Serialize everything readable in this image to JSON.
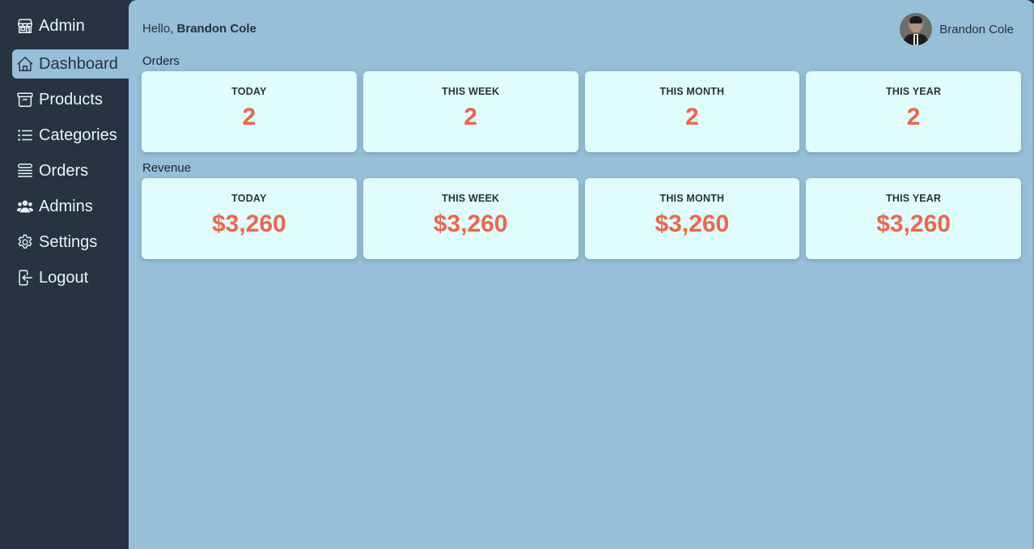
{
  "sidebar": {
    "brand": {
      "label": "Admin",
      "icon": "storefront-icon"
    },
    "items": [
      {
        "label": "Dashboard",
        "icon": "home-icon",
        "active": true
      },
      {
        "label": "Products",
        "icon": "archive-box-icon",
        "active": false
      },
      {
        "label": "Categories",
        "icon": "list-icon",
        "active": false
      },
      {
        "label": "Orders",
        "icon": "queue-list-icon",
        "active": false
      },
      {
        "label": "Admins",
        "icon": "users-icon",
        "active": false
      },
      {
        "label": "Settings",
        "icon": "gear-icon",
        "active": false
      },
      {
        "label": "Logout",
        "icon": "logout-icon",
        "active": false
      }
    ]
  },
  "header": {
    "greeting_prefix": "Hello,",
    "user_name": "Brandon Cole",
    "profile_name": "Brandon Cole"
  },
  "orders": {
    "title": "Orders",
    "cards": [
      {
        "label": "TODAY",
        "value": "2"
      },
      {
        "label": "THIS WEEK",
        "value": "2"
      },
      {
        "label": "THIS MONTH",
        "value": "2"
      },
      {
        "label": "THIS YEAR",
        "value": "2"
      }
    ]
  },
  "revenue": {
    "title": "Revenue",
    "cards": [
      {
        "label": "TODAY",
        "value": "$3,260"
      },
      {
        "label": "THIS WEEK",
        "value": "$3,260"
      },
      {
        "label": "THIS MONTH",
        "value": "$3,260"
      },
      {
        "label": "THIS YEAR",
        "value": "$3,260"
      }
    ]
  },
  "colors": {
    "sidebar_bg": "#283241",
    "main_bg": "#97bfd8",
    "card_bg": "#e1fcfd",
    "accent_value": "#ee6649"
  }
}
